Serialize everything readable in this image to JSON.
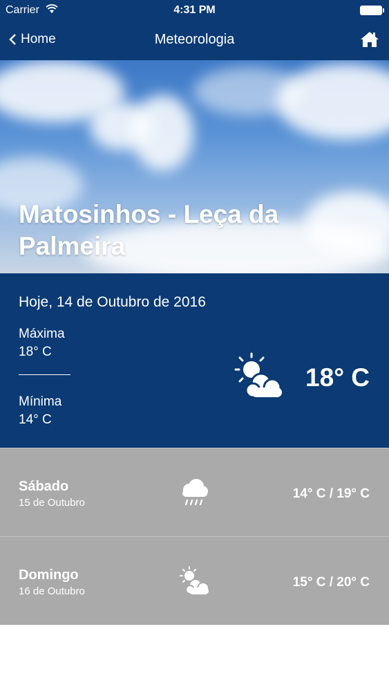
{
  "status_bar": {
    "carrier": "Carrier",
    "time": "4:31 PM"
  },
  "nav": {
    "back_label": "Home",
    "title": "Meteorologia"
  },
  "hero": {
    "location": "Matosinhos - Leça da Palmeira"
  },
  "today": {
    "date": "Hoje, 14 de Outubro de 2016",
    "max_label": "Máxima",
    "max_value": "18° C",
    "min_label": "Mínima",
    "min_value": "14° C",
    "current_temp": "18° C",
    "icon": "sun-cloud-icon"
  },
  "forecast": [
    {
      "day": "Sábado",
      "date": "15 de Outubro",
      "range": "14° C / 19° C",
      "icon": "rain-cloud-icon"
    },
    {
      "day": "Domingo",
      "date": "16 de Outubro",
      "range": "15° C / 20° C",
      "icon": "sun-cloud-icon"
    }
  ],
  "colors": {
    "nav_bg": "#0b3a74",
    "today_bg": "#0b3a74",
    "forecast_bg": "#aaaaaa",
    "text": "#ffffff"
  }
}
